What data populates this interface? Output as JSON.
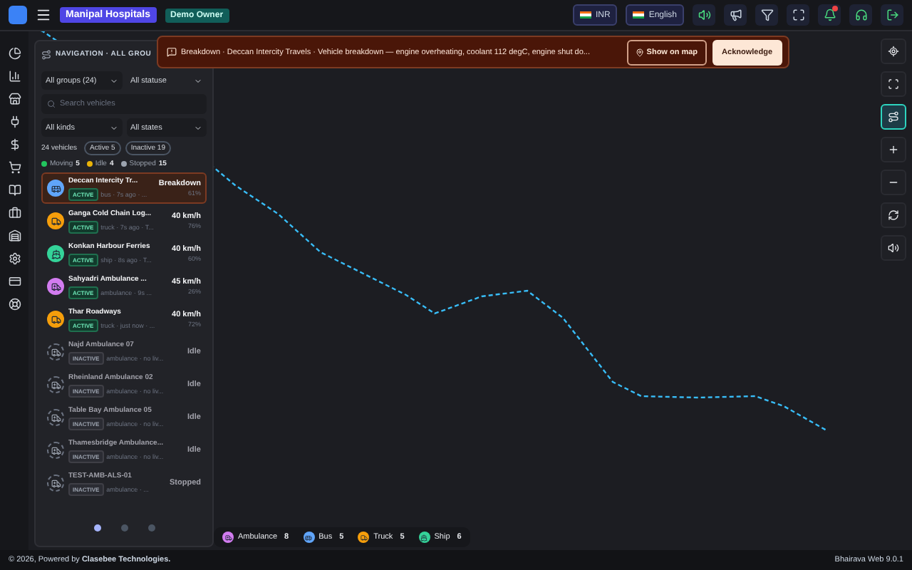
{
  "header": {
    "org": "Manipal Hospitals",
    "role": "Demo Owner",
    "currency": "INR",
    "language": "English",
    "alerts_badge": true
  },
  "panel": {
    "title": "NAVIGATION · ALL GROU",
    "group_select": "All groups (24)",
    "status_select": "All statuse",
    "search": {
      "placeholder": "Search vehicles"
    },
    "kind_select": "All kinds",
    "state_select": "All states",
    "count": "24 vehicles",
    "chips": [
      "Active 5",
      "Inactive 19"
    ],
    "stats": [
      {
        "label": "Moving",
        "value": "5",
        "color": "#22c55e"
      },
      {
        "label": "Idle",
        "value": "4",
        "color": "#eab308"
      },
      {
        "label": "Stopped",
        "value": "15",
        "color": "#9ca3af"
      }
    ],
    "vehicles": [
      {
        "name": "Deccan Intercity Tr...",
        "kind": "bus",
        "active": true,
        "badge": "ACTIVE",
        "sub": "bus · 7s ago · ...",
        "status": "Breakdown",
        "percent": "61%",
        "selected": true
      },
      {
        "name": "Ganga Cold Chain Log...",
        "kind": "truck",
        "active": true,
        "badge": "ACTIVE",
        "sub": "truck · 7s ago · T...",
        "status": "40 km/h",
        "percent": "76%",
        "selected": false
      },
      {
        "name": "Konkan Harbour Ferries",
        "kind": "ship",
        "active": true,
        "badge": "ACTIVE",
        "sub": "ship · 8s ago · T...",
        "status": "40 km/h",
        "percent": "60%",
        "selected": false
      },
      {
        "name": "Sahyadri Ambulance ...",
        "kind": "ambulance",
        "active": true,
        "badge": "ACTIVE",
        "sub": "ambulance · 9s ...",
        "status": "45 km/h",
        "percent": "26%",
        "selected": false
      },
      {
        "name": "Thar Roadways",
        "kind": "truck",
        "active": true,
        "badge": "ACTIVE",
        "sub": "truck · just now · ...",
        "status": "40 km/h",
        "percent": "72%",
        "selected": false
      },
      {
        "name": "Najd Ambulance 07",
        "kind": "ambulance",
        "active": false,
        "badge": "INACTIVE",
        "sub": "ambulance · no liv...",
        "status": "Idle",
        "selected": false
      },
      {
        "name": "Rheinland Ambulance 02",
        "kind": "ambulance",
        "active": false,
        "badge": "INACTIVE",
        "sub": "ambulance · no liv...",
        "status": "Idle",
        "selected": false
      },
      {
        "name": "Table Bay Ambulance 05",
        "kind": "ambulance",
        "active": false,
        "badge": "INACTIVE",
        "sub": "ambulance · no liv...",
        "status": "Idle",
        "selected": false
      },
      {
        "name": "Thamesbridge Ambulance...",
        "kind": "ambulance",
        "active": false,
        "badge": "INACTIVE",
        "sub": "ambulance · no liv...",
        "status": "Idle",
        "selected": false
      },
      {
        "name": "TEST-AMB-ALS-01",
        "kind": "ambulance",
        "active": false,
        "badge": "INACTIVE",
        "sub": "ambulance · ...",
        "status": "Stopped",
        "selected": false
      }
    ],
    "pages": [
      {
        "selected": true
      },
      {
        "selected": false
      },
      {
        "selected": false
      }
    ]
  },
  "alert": {
    "text": "Breakdown · Deccan Intercity Travels · Vehicle breakdown — engine overheating, coolant 112 degC, engine shut do...",
    "show_button": "Show on map",
    "ack_button": "Acknowledge"
  },
  "map_tools": [
    {
      "selected": false
    },
    {
      "selected": false
    },
    {
      "selected": true
    },
    {
      "selected": false
    },
    {
      "selected": false
    },
    {
      "selected": false
    },
    {
      "selected": false
    }
  ],
  "legend": [
    {
      "kind": "ambulance",
      "label": "Ambulance",
      "count": "8"
    },
    {
      "kind": "bus",
      "label": "Bus",
      "count": "5"
    },
    {
      "kind": "truck",
      "label": "Truck",
      "count": "5"
    },
    {
      "kind": "ship",
      "label": "Ship",
      "count": "6"
    }
  ],
  "footer": {
    "credit": "© 2026, Powered by **Clasebee Technologies.**",
    "version": "Bhairava Web 9.0.1"
  }
}
